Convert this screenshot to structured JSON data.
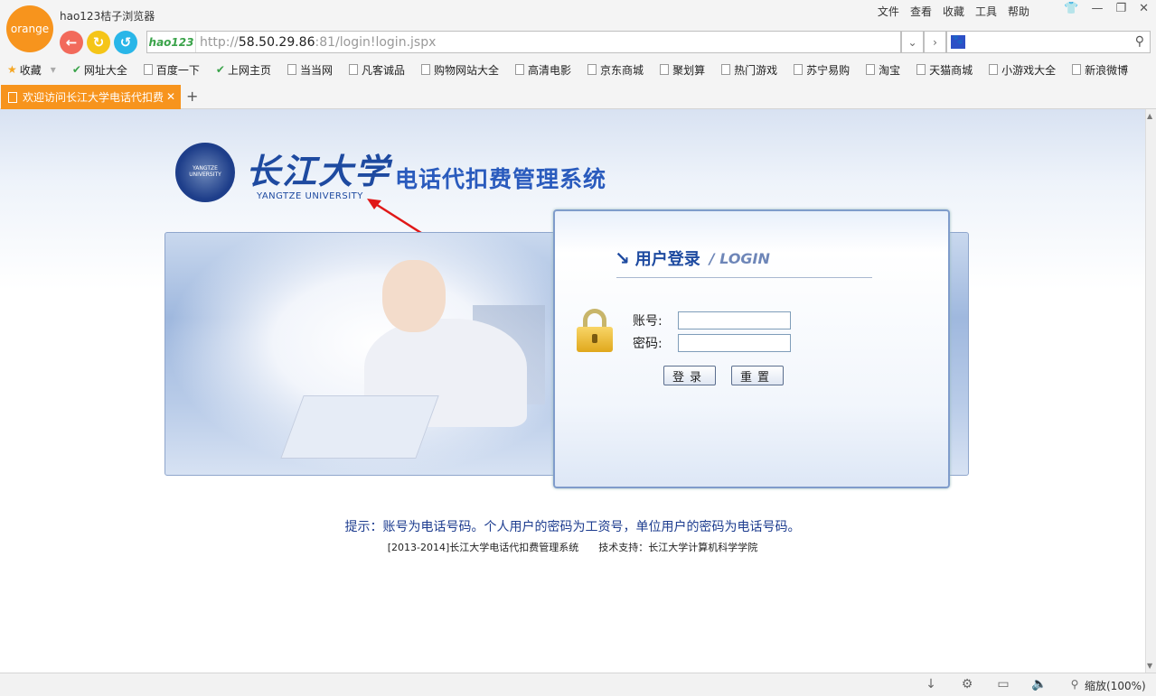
{
  "browser": {
    "app_title": "hao123桔子浏览器",
    "logo_text": "orange",
    "menus": [
      "文件",
      "查看",
      "收藏",
      "工具",
      "帮助"
    ],
    "address": {
      "badge": "hao123",
      "scheme": "http://",
      "host": "58.50.29.86",
      "rest": ":81/login!login.jspx"
    },
    "bookmarks": [
      "收藏",
      "网址大全",
      "百度一下",
      "上网主页",
      "当当网",
      "凡客诚品",
      "购物网站大全",
      "高清电影",
      "京东商城",
      "聚划算",
      "热门游戏",
      "苏宁易购",
      "淘宝",
      "天猫商城",
      "小游戏大全",
      "新浪微博"
    ],
    "tab_title": "欢迎访问长江大学电话代扣费",
    "zoom": "缩放(100%)"
  },
  "page": {
    "brand_cn": "长江大学",
    "brand_en": "YANGTZE UNIVERSITY",
    "seal_text": "YANGTZE UNIVERSITY",
    "system_title": "电话代扣费管理系统",
    "login": {
      "title_cn": "用户登录",
      "title_en": "LOGIN",
      "account_label": "账号:",
      "password_label": "密码:",
      "login_button": "登录",
      "reset_button": "重置"
    },
    "hint": "提示：账号为电话号码。个人用户的密码为工资号，单位用户的密码为电话号码。",
    "footer": "[2013-2014]长江大学电话代扣费管理系统　　技术支持：长江大学计算机科学学院"
  },
  "colors": {
    "accent": "#f7941d",
    "brand_blue": "#1e4aa0",
    "hint_blue": "#1d3c8f"
  }
}
